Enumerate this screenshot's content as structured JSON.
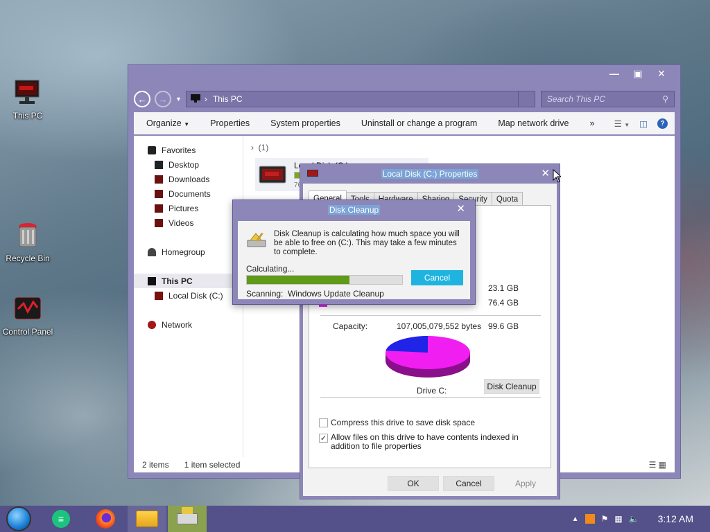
{
  "desktop": {
    "icons": [
      {
        "label": "This PC"
      },
      {
        "label": "Recycle Bin"
      },
      {
        "label": "Control Panel"
      }
    ]
  },
  "explorer": {
    "address": "This PC",
    "search_placeholder": "Search This PC",
    "toolbar": [
      "Organize",
      "Properties",
      "System properties",
      "Uninstall or change a program",
      "Map network drive",
      "»"
    ],
    "nav": {
      "favorites": "Favorites",
      "desktop": "Desktop",
      "downloads": "Downloads",
      "documents": "Documents",
      "pictures": "Pictures",
      "videos": "Videos",
      "homegroup": "Homegroup",
      "this_pc": "This PC",
      "local_disk": "Local Disk (C:)",
      "network": "Network"
    },
    "group_header": "(1)",
    "drive_label": "Local Disk (C:)",
    "drive_free_fragment": "76",
    "status_items": "2 items",
    "status_selected": "1 item selected"
  },
  "properties": {
    "title": "Local Disk (C:) Properties",
    "tabs": [
      "General",
      "Tools",
      "Hardware",
      "Sharing",
      "Security",
      "Quota"
    ],
    "used_value": "23.1 GB",
    "free_value": "76.4 GB",
    "capacity_label": "Capacity:",
    "capacity_bytes": "107,005,079,552 bytes",
    "capacity_gb": "99.6 GB",
    "drive_name": "Drive C:",
    "disk_cleanup_button": "Disk Cleanup",
    "compress_label": "Compress this drive to save disk space",
    "compress_checked": false,
    "index_label": "Allow files on this drive to have contents indexed in addition to file properties",
    "index_checked": true,
    "ok": "OK",
    "cancel": "Cancel",
    "apply": "Apply",
    "used_color": "#1f24e6",
    "free_color": "#f01ef0",
    "used_fraction": 0.232
  },
  "cleanup": {
    "title": "Disk Cleanup",
    "message": "Disk Cleanup is calculating how much space you will be able to free on  (C:). This may take a few minutes to complete.",
    "calculating": "Calculating...",
    "progress_fraction": 0.66,
    "cancel": "Cancel",
    "scanning_label": "Scanning:",
    "scanning_item": "Windows Update Cleanup"
  },
  "taskbar": {
    "clock": "3:12 AM",
    "accent": "#54508a"
  }
}
